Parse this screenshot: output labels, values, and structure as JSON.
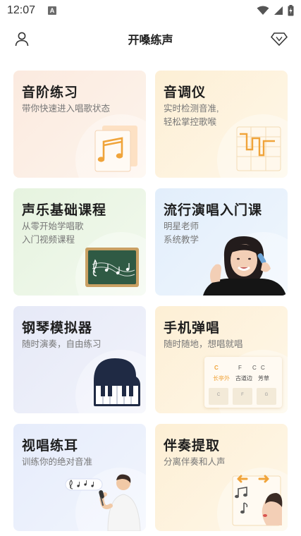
{
  "status_bar": {
    "time": "12:07",
    "notification_letter": "A"
  },
  "header": {
    "title": "开嗓练声"
  },
  "cards": [
    {
      "title": "音阶练习",
      "subtitle": "带你快速进入唱歌状态"
    },
    {
      "title": "音调仪",
      "subtitle": "实时检测音准,\n轻松掌控歌喉"
    },
    {
      "title": "声乐基础课程",
      "subtitle": "从零开始学唱歌\n入门视频课程"
    },
    {
      "title": "流行演唱入门课",
      "subtitle": "明星老师\n系统教学"
    },
    {
      "title": "钢琴模拟器",
      "subtitle": "随时演奏，自由练习"
    },
    {
      "title": "手机弹唱",
      "subtitle": "随时随地，想唱就唱"
    },
    {
      "title": "视唱练耳",
      "subtitle": "训练你的绝对音准"
    },
    {
      "title": "伴奏提取",
      "subtitle": "分离伴奏和人声"
    }
  ],
  "chord_sheet": {
    "chords": [
      "C",
      "F",
      "C",
      "C"
    ],
    "lyrics": [
      "长亭外",
      "古道边",
      "芳草"
    ],
    "keys": [
      "C",
      "F",
      "G"
    ]
  },
  "colors": {
    "accent": "#f0a43a",
    "chalkboard": "#2f5a44",
    "piano_body": "#1f2a44"
  }
}
